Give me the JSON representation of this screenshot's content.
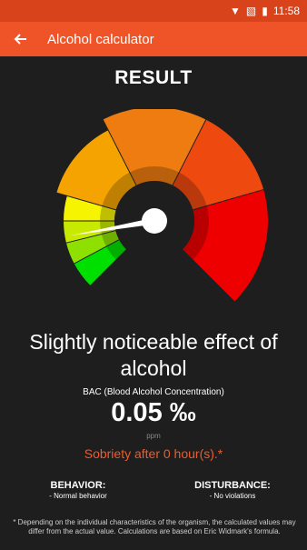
{
  "status_bar": {
    "time": "11:58"
  },
  "app_bar": {
    "title": "Alcohol calculator"
  },
  "result_title": "RESULT",
  "gauge": {
    "level_fraction": 0.13,
    "segment_colors": [
      "#00e000",
      "#8ee000",
      "#c8ea00",
      "#f6f400",
      "#f5a300",
      "#ee7c10",
      "#ee4a10",
      "#ee0000"
    ]
  },
  "effect_text": "Slightly noticeable effect of alcohol",
  "bac": {
    "label": "BAC (Blood Alcohol Concentration)",
    "value": "0.05 ‰",
    "unit": "ppm"
  },
  "sobriety_text": "Sobriety after  0 hour(s).*",
  "behavior": {
    "heading": "BEHAVIOR:",
    "value": "- Normal behavior"
  },
  "disturbance": {
    "heading": "DISTURBANCE:",
    "value": "- No violations"
  },
  "footnote": "* Depending on the individual characteristics of the organism, the calculated values may differ from the actual value. Calculations are based on Eric Widmark's formula.",
  "colors": {
    "accent": "#ef5428",
    "status_bar": "#d8431c",
    "background": "#1e1e1e"
  }
}
